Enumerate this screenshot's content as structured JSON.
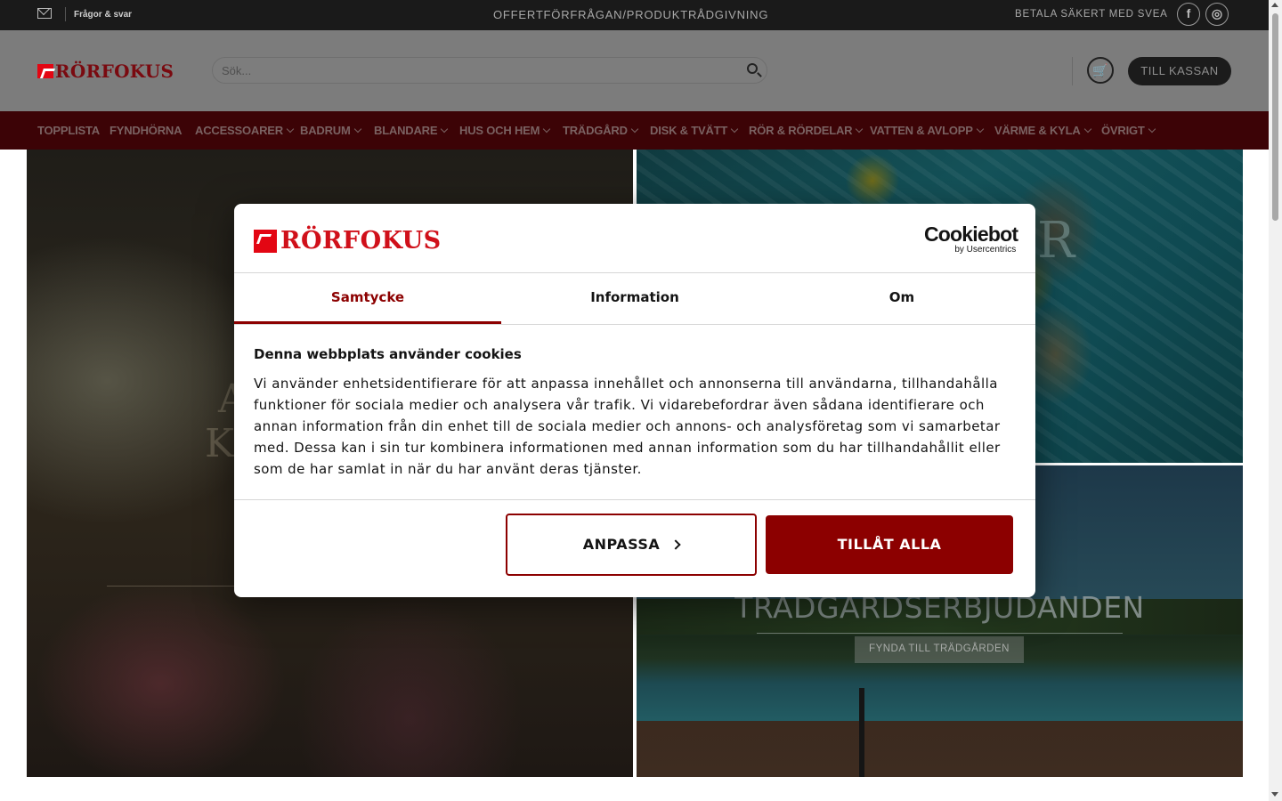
{
  "topbar": {
    "faq_label": "Frågor & svar",
    "center_link": "OFFERTFÖRFRÅGAN/PRODUKTRÅDGIVNING",
    "payment_text": "BETALA SÄKERT MED SVEA",
    "social": [
      {
        "icon": "facebook-icon",
        "glyph": "f"
      },
      {
        "icon": "instagram-icon",
        "glyph": "◎"
      }
    ]
  },
  "header": {
    "logo_text": "RÖRFOKUS",
    "search_placeholder": "Sök...",
    "cart_glyph": "🛒",
    "checkout_label": "TILL KASSAN"
  },
  "nav": {
    "items": [
      {
        "label": "TOPPLISTA",
        "dropdown": false
      },
      {
        "label": "FYNDHÖRNA",
        "dropdown": false
      },
      {
        "label": "ACCESSOARER",
        "dropdown": true
      },
      {
        "label": "BADRUM",
        "dropdown": true
      },
      {
        "label": "BLANDARE",
        "dropdown": true
      },
      {
        "label": "HUS OCH HEM",
        "dropdown": true
      },
      {
        "label": "TRÄDGÅRD",
        "dropdown": true
      },
      {
        "label": "DISK & TVÄTT",
        "dropdown": true
      },
      {
        "label": "RÖR & RÖRDELAR",
        "dropdown": true
      },
      {
        "label": "VATTEN & AVLOPP",
        "dropdown": true
      },
      {
        "label": "VÄRME & KYLA",
        "dropdown": true
      },
      {
        "label": "ÖVRIGT",
        "dropdown": true
      }
    ]
  },
  "hero": {
    "left_ghost_1": "A",
    "left_ghost_2": "K",
    "top_right_ghost": "R",
    "bottom_right_title": "TRÄDGÅRDSERBJUDANDEN",
    "bottom_right_button": "FYNDA TILL TRÄDGÅRDEN"
  },
  "cookie_dialog": {
    "logo_text": "RÖRFOKUS",
    "provider_name": "Cookiebot",
    "provider_sub": "by Usercentrics",
    "tabs": [
      {
        "label": "Samtycke",
        "active": true
      },
      {
        "label": "Information",
        "active": false
      },
      {
        "label": "Om",
        "active": false
      }
    ],
    "heading": "Denna webbplats använder cookies",
    "body": "Vi använder enhetsidentifierare för att anpassa innehållet och annonserna till användarna, tillhandahålla funktioner för sociala medier och analysera vår trafik. Vi vidarebefordrar även sådana identifierare och annan information från din enhet till de sociala medier och annons- och analysföretag som vi samarbetar med. Dessa kan i sin tur kombinera informationen med annan information som du har tillhandahållit eller som de har samlat in när du har använt deras tjänster.",
    "customize_label": "ANPASSA",
    "allow_all_label": "TILLÅT ALLA"
  },
  "colors": {
    "brand_red": "#e30613",
    "dialog_accent": "#8c0000",
    "topbar_bg": "#1a1a1a"
  }
}
